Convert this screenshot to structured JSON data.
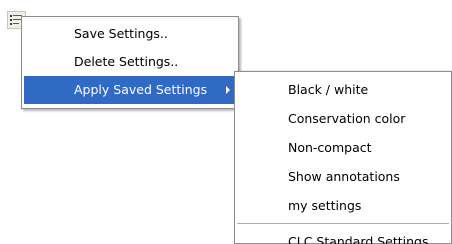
{
  "trigger": {
    "icon": "settings-list-icon"
  },
  "main_menu": {
    "items": [
      {
        "label": "Save Settings.."
      },
      {
        "label": "Delete Settings.."
      },
      {
        "label": "Apply Saved Settings",
        "active": true,
        "has_submenu": true
      }
    ]
  },
  "submenu": {
    "items": [
      {
        "label": "Black / white"
      },
      {
        "label": "Conservation color"
      },
      {
        "label": "Non-compact"
      },
      {
        "label": "Show annotations"
      },
      {
        "label": "my settings"
      }
    ],
    "footer_item": {
      "label": "CLC Standard Settings"
    }
  },
  "colors": {
    "highlight": "#316ac5",
    "highlight_text": "#ffffff",
    "menu_border": "#8e8e8e",
    "separator": "#a9a9a9"
  }
}
